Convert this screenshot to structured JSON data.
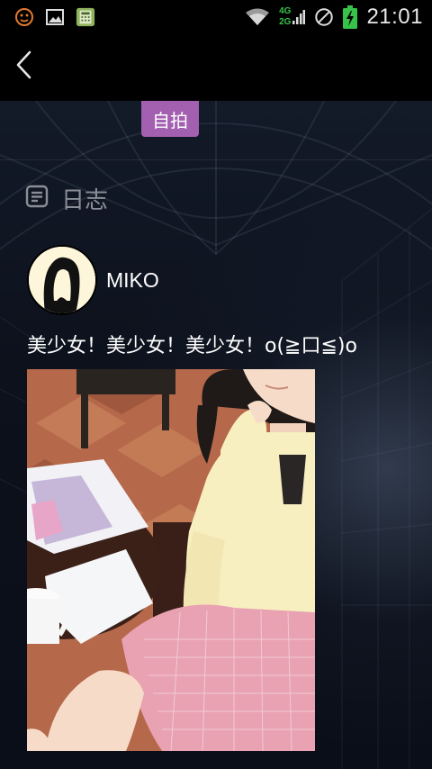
{
  "status_bar": {
    "time": "21:01",
    "network_top": "4G",
    "network_bottom": "2G",
    "left_icons": [
      "notification-face-icon",
      "image-icon",
      "calculator-app-icon"
    ],
    "right_icons": [
      "wifi-icon",
      "signal-bars-icon",
      "no-sim-icon",
      "battery-charging-icon"
    ]
  },
  "app_bar": {
    "back_icon": "back-arrow-icon"
  },
  "tag": {
    "label": "自拍",
    "color": "#a35fb0"
  },
  "section": {
    "title": "日志",
    "icon": "journal-icon"
  },
  "post": {
    "author": "MIKO",
    "text": "美少女！美少女！美少女！o(≧口≦)o",
    "image": "anime-girl-photo"
  }
}
